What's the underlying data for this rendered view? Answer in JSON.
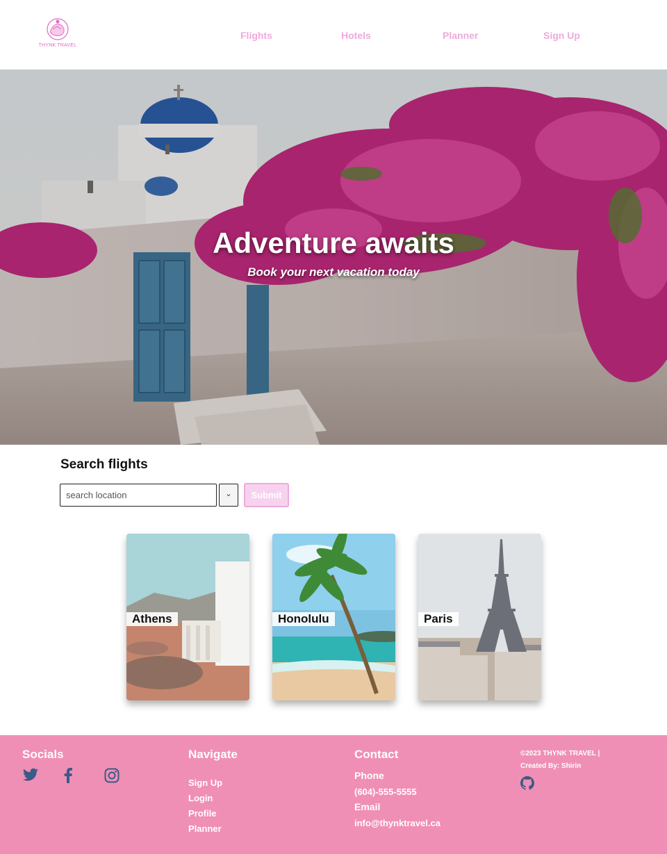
{
  "brand": {
    "logo_text": "THYNK TRAVEL",
    "accent": "#efa9dc",
    "footer_bg": "#f08fb5"
  },
  "nav": {
    "flights": "Flights",
    "hotels": "Hotels",
    "planner": "Planner",
    "signup": "Sign Up"
  },
  "hero": {
    "title": "Adventure awaits",
    "subtitle": "Book your next vacation today"
  },
  "search": {
    "title": "Search flights",
    "placeholder": "search location",
    "dropdown_icon": "chevron-down-icon",
    "submit_label": "Submit"
  },
  "cards": [
    {
      "label": "Athens"
    },
    {
      "label": "Honolulu"
    },
    {
      "label": "Paris"
    }
  ],
  "footer": {
    "socials": {
      "title": "Socials",
      "icons": [
        "twitter-icon",
        "facebook-icon",
        "instagram-icon"
      ]
    },
    "navigate": {
      "title": "Navigate",
      "links": [
        "Sign Up",
        "Login",
        "Profile",
        "Planner"
      ]
    },
    "contact": {
      "title": "Contact",
      "phone_label": "Phone",
      "phone": "(604)-555-5555",
      "email_label": "Email",
      "email": "info@thynktravel.ca"
    },
    "copyright_line1": "©2023 THYNK TRAVEL |",
    "copyright_line2": "Created By: Shirin",
    "github_icon": "github-icon"
  }
}
